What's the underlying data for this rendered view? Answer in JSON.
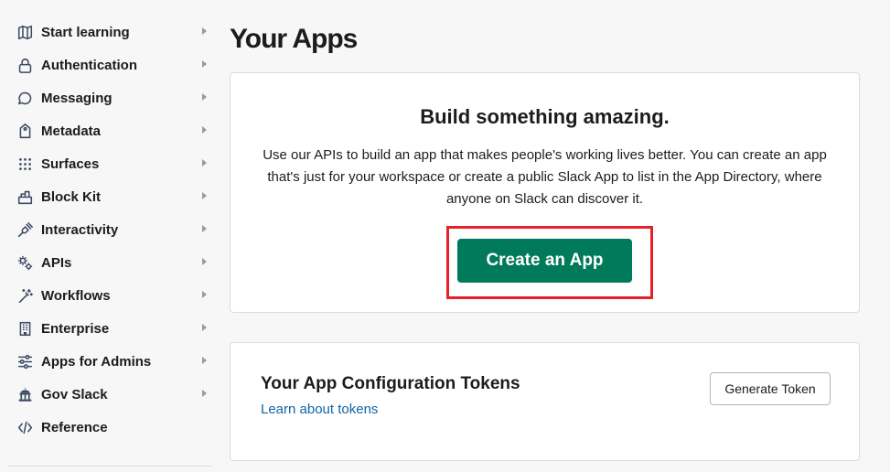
{
  "sidebar": {
    "items": [
      {
        "label": "Start learning",
        "icon": "map-icon",
        "has_caret": true
      },
      {
        "label": "Authentication",
        "icon": "lock-icon",
        "has_caret": true
      },
      {
        "label": "Messaging",
        "icon": "message-icon",
        "has_caret": true
      },
      {
        "label": "Metadata",
        "icon": "tag-icon",
        "has_caret": true
      },
      {
        "label": "Surfaces",
        "icon": "grid-dots-icon",
        "has_caret": true
      },
      {
        "label": "Block Kit",
        "icon": "blocks-icon",
        "has_caret": true
      },
      {
        "label": "Interactivity",
        "icon": "plug-icon",
        "has_caret": true
      },
      {
        "label": "APIs",
        "icon": "gears-icon",
        "has_caret": true
      },
      {
        "label": "Workflows",
        "icon": "magic-wand-icon",
        "has_caret": true
      },
      {
        "label": "Enterprise",
        "icon": "building-icon",
        "has_caret": true
      },
      {
        "label": "Apps for Admins",
        "icon": "sliders-icon",
        "has_caret": true
      },
      {
        "label": "Gov Slack",
        "icon": "government-building-icon",
        "has_caret": true
      },
      {
        "label": "Reference",
        "icon": "code-icon",
        "has_caret": false
      }
    ]
  },
  "main": {
    "title": "Your Apps",
    "hero": {
      "title": "Build something amazing.",
      "description": "Use our APIs to build an app that makes people's working lives better. You can create an app that's just for your workspace or create a public Slack App to list in the App Directory, where anyone on Slack can discover it.",
      "cta_label": "Create an App"
    },
    "tokens": {
      "title": "Your App Configuration Tokens",
      "link_label": "Learn about tokens",
      "button_label": "Generate Token"
    }
  },
  "colors": {
    "primary_button": "#007a5a",
    "link": "#1264a3",
    "highlight_border": "#e8202a",
    "page_background": "#f7f7f7"
  }
}
